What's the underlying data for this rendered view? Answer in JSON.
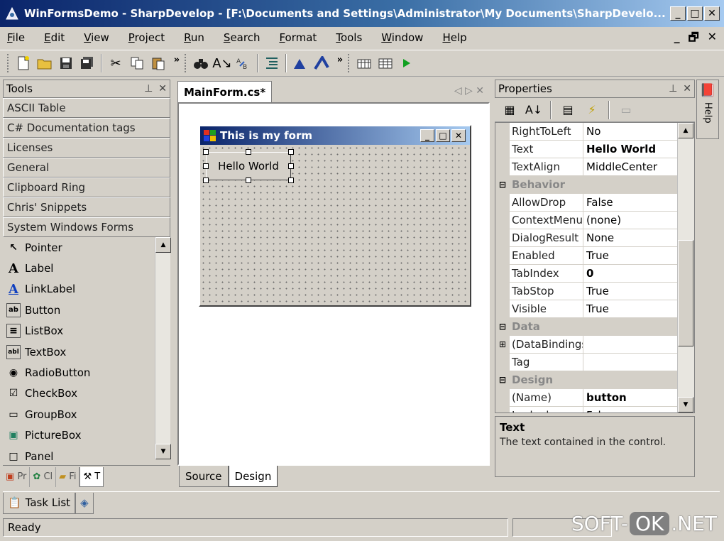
{
  "window": {
    "title": "WinFormsDemo - SharpDevelop - [F:\\Documents and Settings\\Administrator\\My Documents\\SharpDevelo...",
    "min": "_",
    "max": "□",
    "close": "✕"
  },
  "menu": {
    "items": [
      "File",
      "Edit",
      "View",
      "Project",
      "Run",
      "Search",
      "Format",
      "Tools",
      "Window",
      "Help"
    ],
    "mdi_restore": "_ ▫ ✕"
  },
  "toolbar": {
    "chevron": "»"
  },
  "tools": {
    "header": "Tools",
    "pin": "📌",
    "close": "✕",
    "categories": [
      "ASCII Table",
      "C# Documentation tags",
      "Licenses",
      "General",
      "Clipboard Ring",
      "Chris' Snippets",
      "System Windows Forms"
    ],
    "items": [
      {
        "icon": "↖",
        "label": "Pointer"
      },
      {
        "icon": "A",
        "label": "Label"
      },
      {
        "icon": "A",
        "label": "LinkLabel"
      },
      {
        "icon": "ab",
        "label": "Button"
      },
      {
        "icon": "≡",
        "label": "ListBox"
      },
      {
        "icon": "abl",
        "label": "TextBox"
      },
      {
        "icon": "◉",
        "label": "RadioButton"
      },
      {
        "icon": "☑",
        "label": "CheckBox"
      },
      {
        "icon": "▭",
        "label": "GroupBox"
      },
      {
        "icon": "▣",
        "label": "PictureBox"
      },
      {
        "icon": "□",
        "label": "Panel"
      }
    ],
    "bottom_tabs": [
      "Pr",
      "Cl",
      "Fi",
      "T"
    ]
  },
  "editor": {
    "tab": "MainForm.cs*",
    "nav": "◁ ▷ ✕",
    "form_title": "This is my form",
    "button_text": "Hello World",
    "bottom_tabs": [
      "Source",
      "Design"
    ]
  },
  "properties": {
    "header": "Properties",
    "rows": [
      {
        "type": "prop",
        "name": "RightToLeft",
        "value": "No",
        "bold": false
      },
      {
        "type": "prop",
        "name": "Text",
        "value": "Hello World",
        "bold": true
      },
      {
        "type": "prop",
        "name": "TextAlign",
        "value": "MiddleCenter",
        "bold": false
      },
      {
        "type": "cat",
        "name": "Behavior",
        "value": ""
      },
      {
        "type": "prop",
        "name": "AllowDrop",
        "value": "False",
        "bold": false
      },
      {
        "type": "prop",
        "name": "ContextMenu",
        "value": "(none)",
        "bold": false
      },
      {
        "type": "prop",
        "name": "DialogResult",
        "value": "None",
        "bold": false
      },
      {
        "type": "prop",
        "name": "Enabled",
        "value": "True",
        "bold": false
      },
      {
        "type": "prop",
        "name": "TabIndex",
        "value": "0",
        "bold": true
      },
      {
        "type": "prop",
        "name": "TabStop",
        "value": "True",
        "bold": false
      },
      {
        "type": "prop",
        "name": "Visible",
        "value": "True",
        "bold": false
      },
      {
        "type": "cat",
        "name": "Data",
        "value": ""
      },
      {
        "type": "expand",
        "name": "(DataBindings",
        "value": "",
        "bold": false
      },
      {
        "type": "prop",
        "name": "Tag",
        "value": "",
        "bold": false
      },
      {
        "type": "cat",
        "name": "Design",
        "value": ""
      },
      {
        "type": "prop",
        "name": "(Name)",
        "value": "button",
        "bold": true
      },
      {
        "type": "prop",
        "name": "Locked",
        "value": "False",
        "bold": false
      }
    ],
    "desc_title": "Text",
    "desc_text": "The text contained in the control."
  },
  "help_strip": {
    "label": "Help"
  },
  "tasklist": {
    "label": "Task List"
  },
  "status": {
    "text": "Ready"
  },
  "watermark": {
    "pre": "SOFT-",
    "ok": "OK",
    "post": ".NET"
  }
}
